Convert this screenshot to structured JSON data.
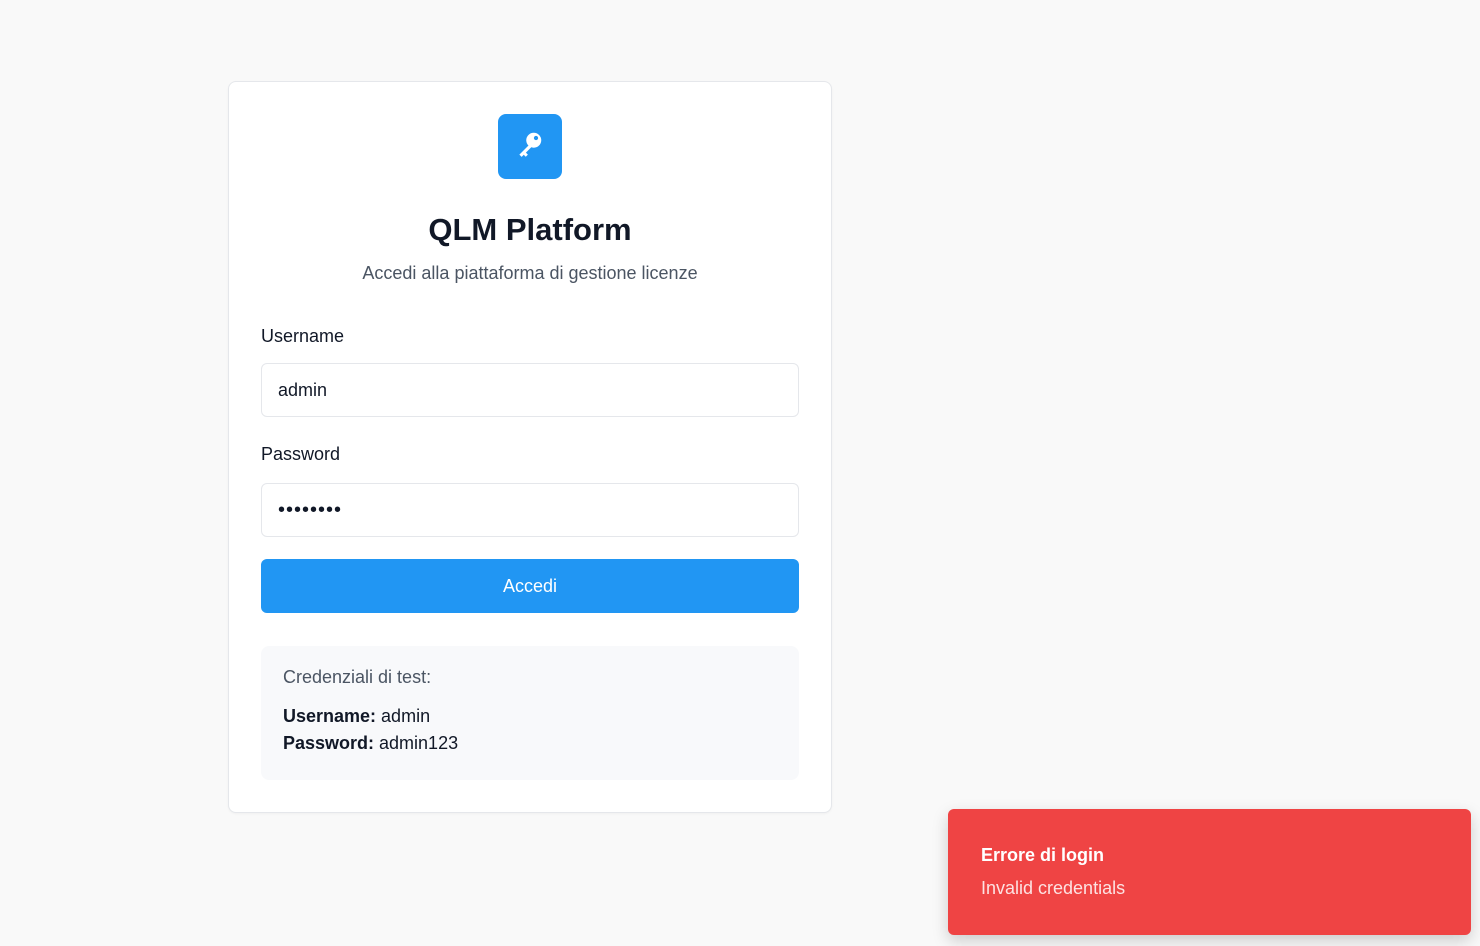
{
  "app": {
    "title": "QLM Platform",
    "subtitle": "Accedi alla piattaforma di gestione licenze",
    "logo_icon": "key-icon",
    "accent_color": "#2196f3"
  },
  "form": {
    "username_label": "Username",
    "username_value": "admin",
    "password_label": "Password",
    "password_value": "admin123",
    "submit_label": "Accedi"
  },
  "test_credentials": {
    "title": "Credenziali di test:",
    "username_key": "Username:",
    "username_value": " admin",
    "password_key": "Password:",
    "password_value": " admin123"
  },
  "toast": {
    "title": "Errore di login",
    "message": "Invalid credentials",
    "color": "#ef4444"
  }
}
